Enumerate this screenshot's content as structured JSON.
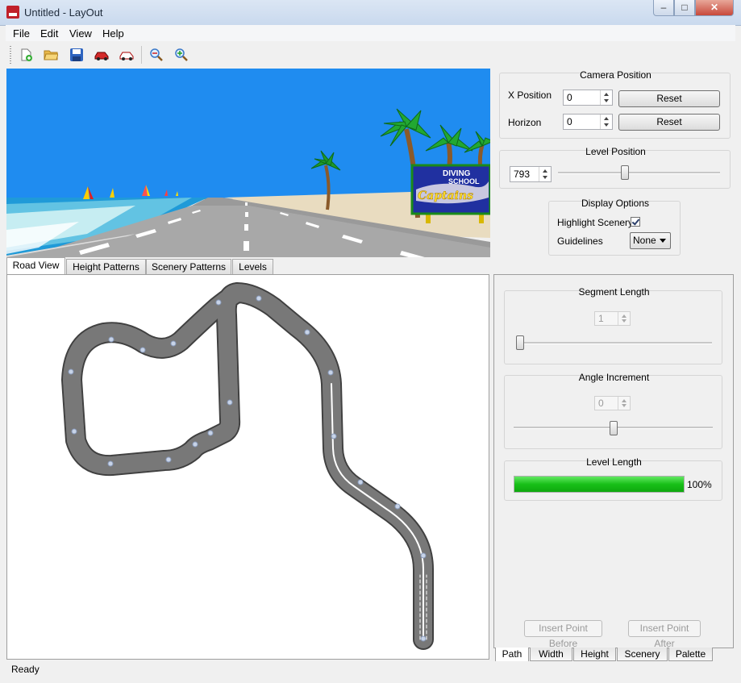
{
  "window": {
    "title": "Untitled - LayOut",
    "minimize": "–",
    "maximize": "□",
    "close": "✕"
  },
  "menu": [
    "File",
    "Edit",
    "View",
    "Help"
  ],
  "toolbar": {
    "icons": [
      "new-file-icon",
      "open-folder-icon",
      "save-icon",
      "car-icon",
      "car-outline-icon",
      "zoom-out-icon",
      "zoom-in-icon"
    ]
  },
  "preview": {
    "billboard_line1": "DIVING",
    "billboard_line2": "SCHOOL",
    "billboard_line3": "Captains",
    "sky_color": "#1f8cf0",
    "road_color": "#9a9a9a"
  },
  "camera": {
    "title": "Camera Position",
    "x_label": "X Position",
    "x_value": "0",
    "horizon_label": "Horizon",
    "horizon_value": "0",
    "reset_label": "Reset"
  },
  "level_position": {
    "title": "Level Position",
    "value": "793",
    "slider_fraction": 0.41
  },
  "display_options": {
    "title": "Display Options",
    "highlight_label": "Highlight Scenery",
    "highlight_checked": true,
    "guidelines_label": "Guidelines",
    "guidelines_value": "None"
  },
  "tabs": [
    "Road View",
    "Height Patterns",
    "Scenery Patterns",
    "Levels"
  ],
  "segment_length": {
    "title": "Segment Length",
    "value": "1",
    "slider_fraction": 0.0
  },
  "angle_increment": {
    "title": "Angle Increment",
    "value": "0",
    "slider_fraction": 0.5
  },
  "level_length": {
    "title": "Level Length",
    "percent_label": "100%",
    "fraction": 1.0,
    "bar_color": "#1fd01f"
  },
  "actions": {
    "insert_before": "Insert Point Before",
    "insert_after": "Insert Point After"
  },
  "bottom_tabs": [
    "Path",
    "Width",
    "Height",
    "Scenery",
    "Palette"
  ],
  "status": "Ready"
}
